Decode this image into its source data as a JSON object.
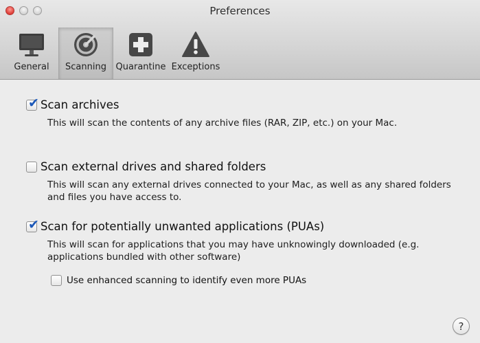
{
  "window": {
    "title": "Preferences"
  },
  "toolbar": {
    "selected": "Scanning",
    "items": [
      {
        "label": "General",
        "icon": "monitor-icon"
      },
      {
        "label": "Scanning",
        "icon": "scan-radar-icon"
      },
      {
        "label": "Quarantine",
        "icon": "plus-cross-icon"
      },
      {
        "label": "Exceptions",
        "icon": "warning-triangle-icon"
      }
    ]
  },
  "options": [
    {
      "label": "Scan archives",
      "checked": true,
      "description": "This will scan the contents of any archive files (RAR, ZIP, etc.) on your Mac."
    },
    {
      "label": "Scan external drives and shared folders",
      "checked": false,
      "description": "This will scan any external drives connected to your Mac, as well as any shared folders and files you have access to."
    },
    {
      "label": "Scan for potentially unwanted applications (PUAs)",
      "checked": true,
      "description": "This will scan for applications that you may have unknowingly downloaded (e.g. applications bundled with other software)",
      "sub_option": {
        "label": "Use enhanced scanning to identify even more PUAs",
        "checked": false
      }
    }
  ],
  "help": {
    "label": "?"
  },
  "colors": {
    "checkmark": "#1c58b8",
    "close_button": "#dd3b34"
  }
}
